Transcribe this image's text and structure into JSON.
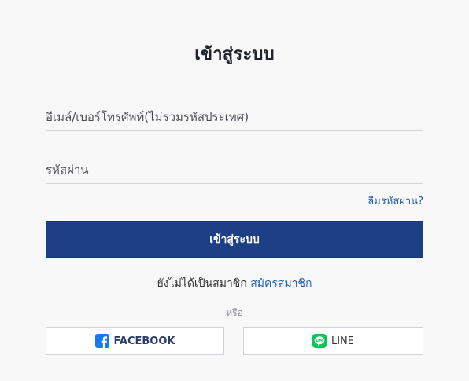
{
  "login": {
    "title": "เข้าสู่ระบบ",
    "email_placeholder": "อีเมล์/เบอร์โทรศัพท์(ไม่รวมรหัสประเทศ)",
    "password_placeholder": "รหัสผ่าน",
    "forgot_label": "ลืมรหัสผ่าน?",
    "submit_label": "เข้าสู่ระบบ"
  },
  "register": {
    "prompt": "ยังไม่ได้เป็นสมาชิก",
    "link_label": "สมัครสมาชิก"
  },
  "divider": {
    "label": "หรือ"
  },
  "social": {
    "facebook_label": "FACEBOOK",
    "facebook_icon": "facebook-icon",
    "facebook_color": "#1877f2",
    "line_label": "LINE",
    "line_icon": "line-icon",
    "line_color": "#06c755"
  },
  "colors": {
    "primary": "#1c3f85",
    "link": "#1c5fb0",
    "background": "#f8f8f9"
  }
}
